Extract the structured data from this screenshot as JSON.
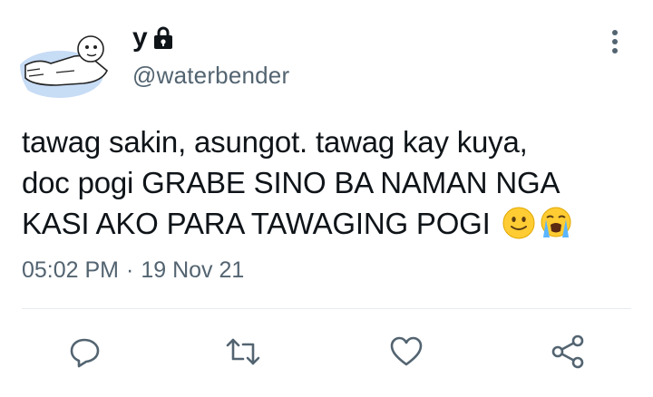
{
  "author": {
    "display_name": "y",
    "handle": "@waterbender",
    "protected": true
  },
  "tweet": {
    "text_lines": [
      "tawag sakin, asungot. tawag kay kuya,",
      "doc pogi GRABE SINO BA NAMAN NGA",
      "KASI AKO PARA TAWAGING POGI"
    ],
    "emojis": [
      "slightly-smiling-face",
      "loudly-crying-face"
    ],
    "time": "05:02 PM",
    "separator": "·",
    "date": "19 Nov 21"
  },
  "actions": [
    "reply",
    "retweet",
    "like",
    "share"
  ],
  "colors": {
    "text": "#0f1419",
    "secondary": "#536471",
    "icon": "#536471",
    "divider": "#e6ecf0",
    "avatar_blue": "#c7dcf5"
  }
}
